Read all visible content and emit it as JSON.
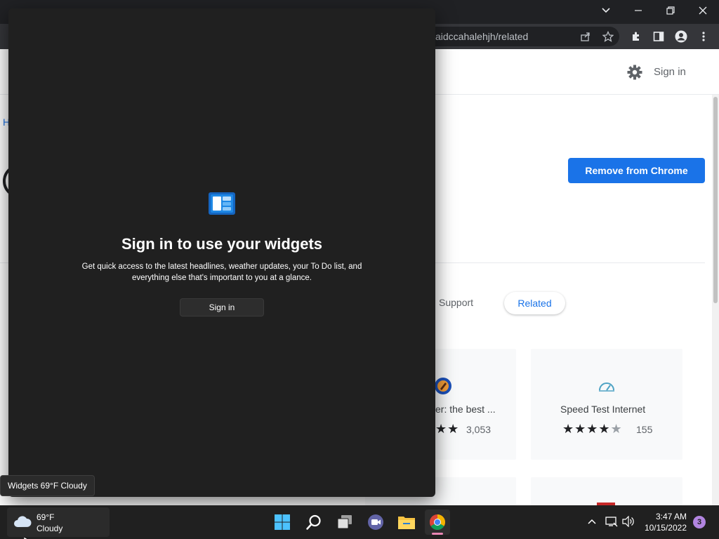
{
  "browser": {
    "url_fragment": "aidccahalehjh/related",
    "window_controls": [
      "chevron-down-icon",
      "minimize-icon",
      "restore-icon",
      "close-icon"
    ]
  },
  "store_page": {
    "header_signin": "Sign in",
    "breadcrumb_partial": "H",
    "remove_button": "Remove from Chrome",
    "tabs": {
      "support": "Support",
      "related": "Related"
    },
    "cards": [
      {
        "title": "er: the best ...",
        "rating": 5,
        "count": "3,053"
      },
      {
        "title": "Speed Test Internet",
        "rating": 4,
        "count": "155"
      }
    ]
  },
  "widgets": {
    "title": "Sign in to use your widgets",
    "description": "Get quick access to the latest headlines, weather updates, your To Do list, and everything else that's important to you at a glance.",
    "signin_button": "Sign in",
    "tooltip": "Widgets 69°F Cloudy"
  },
  "taskbar": {
    "weather": {
      "temp": "69°F",
      "condition": "Cloudy"
    },
    "apps": [
      "start-icon",
      "search-icon",
      "task-view-icon",
      "teams-chat-icon",
      "file-explorer-icon",
      "chrome-icon"
    ],
    "clock": {
      "time": "3:47 AM",
      "date": "10/15/2022"
    },
    "notifications": "3"
  },
  "colors": {
    "accent": "#1a73e8",
    "widgets_bg": "#202020",
    "taskbar_bg": "#202020"
  }
}
